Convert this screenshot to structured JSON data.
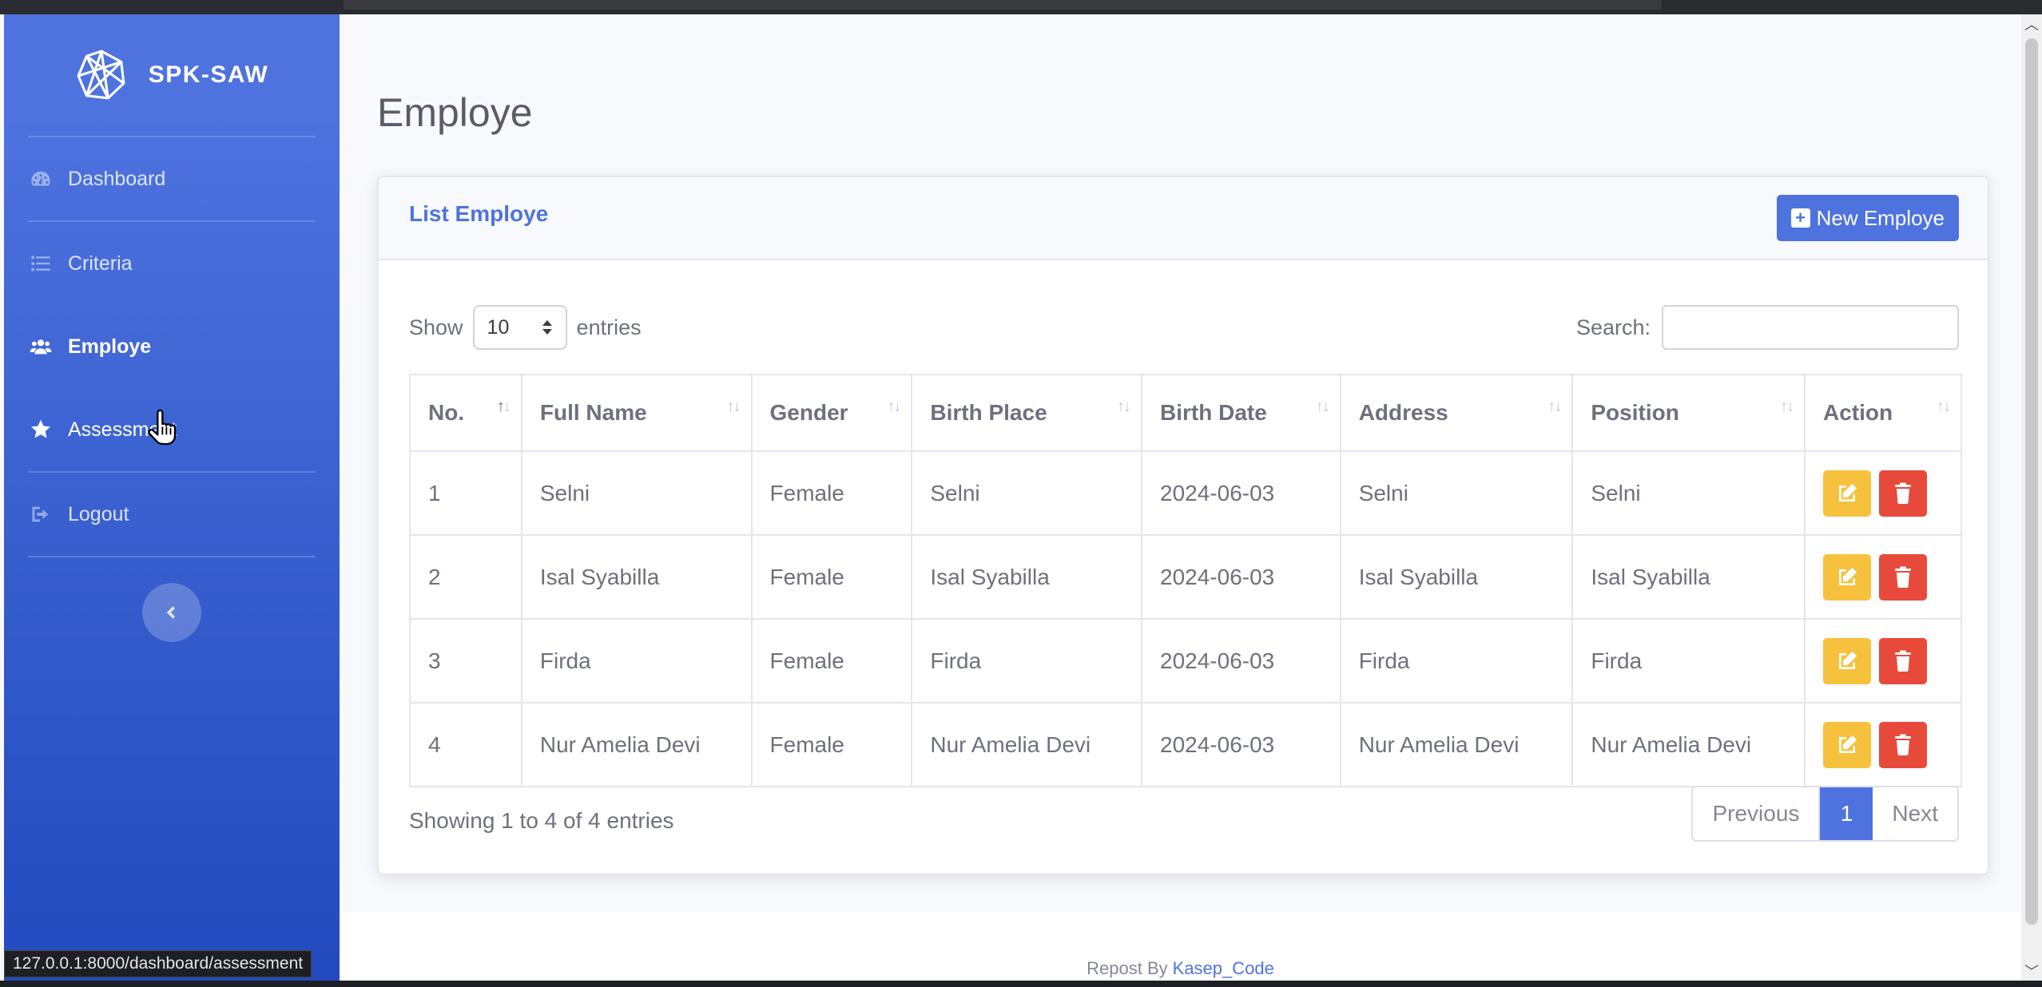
{
  "brand": {
    "name": "SPK-SAW",
    "logo_icon": "geodesic-sphere-icon"
  },
  "sidebar": {
    "items": [
      {
        "label": "Dashboard",
        "icon": "gauge-icon",
        "active": false
      },
      {
        "label": "Criteria",
        "icon": "list-icon",
        "active": false
      },
      {
        "label": "Employe",
        "icon": "users-icon",
        "active": true
      },
      {
        "label": "Assessment",
        "icon": "star-icon",
        "active": false
      },
      {
        "label": "Logout",
        "icon": "sign-out-icon",
        "active": false
      }
    ],
    "toggle_icon": "chevron-left-icon"
  },
  "page": {
    "title": "Employe"
  },
  "card": {
    "title": "List Employe",
    "new_button": "New Employe"
  },
  "controls": {
    "show_label": "Show",
    "entries_value": "10",
    "entries_label": "entries",
    "search_label": "Search:",
    "search_value": ""
  },
  "table": {
    "headers": [
      "No.",
      "Full Name",
      "Gender",
      "Birth Place",
      "Birth Date",
      "Address",
      "Position",
      "Action"
    ],
    "rows": [
      [
        "1",
        "Selni",
        "Female",
        "Selni",
        "2024-06-03",
        "Selni",
        "Selni"
      ],
      [
        "2",
        "Isal Syabilla",
        "Female",
        "Isal Syabilla",
        "2024-06-03",
        "Isal Syabilla",
        "Isal Syabilla"
      ],
      [
        "3",
        "Firda",
        "Female",
        "Firda",
        "2024-06-03",
        "Firda",
        "Firda"
      ],
      [
        "4",
        "Nur Amelia Devi",
        "Female",
        "Nur Amelia Devi",
        "2024-06-03",
        "Nur Amelia Devi",
        "Nur Amelia Devi"
      ]
    ]
  },
  "pagination": {
    "info": "Showing 1 to 4 of 4 entries",
    "previous": "Previous",
    "current": "1",
    "next": "Next"
  },
  "footer": {
    "text": "Repost By",
    "link": "Kasep_Code"
  },
  "status_bar": {
    "url": "127.0.0.1:8000/dashboard/assessment"
  },
  "colors": {
    "primary": "#4e73df",
    "warning": "#f6c23e",
    "danger": "#e74a3b",
    "text": "#6e707e"
  }
}
